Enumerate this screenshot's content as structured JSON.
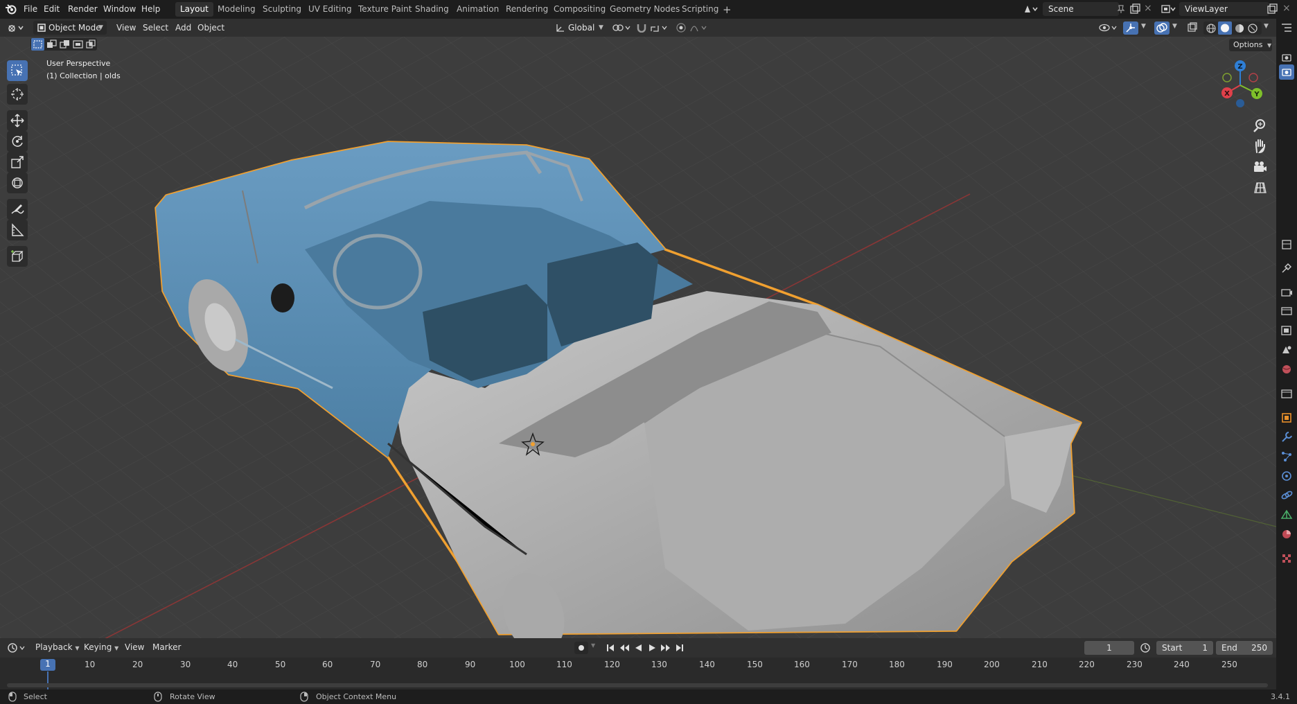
{
  "app": {
    "version": "3.4.1"
  },
  "menus": [
    "File",
    "Edit",
    "Render",
    "Window",
    "Help"
  ],
  "workspaces": [
    "Layout",
    "Modeling",
    "Sculpting",
    "UV Editing",
    "Texture Paint",
    "Shading",
    "Animation",
    "Rendering",
    "Compositing",
    "Geometry Nodes",
    "Scripting"
  ],
  "active_workspace": "Layout",
  "scene": {
    "name": "Scene"
  },
  "view_layer": {
    "name": "ViewLayer"
  },
  "header": {
    "mode": "Object Mode",
    "menu_view": "View",
    "menu_select": "Select",
    "menu_add": "Add",
    "menu_object": "Object",
    "transform_orientation": "Global",
    "options": "Options"
  },
  "viewport": {
    "perspective_label": "User Perspective",
    "collection_label": "(1) Collection | olds",
    "gizmo_axes": {
      "x": "X",
      "y": "Y",
      "z": "Z"
    },
    "colors": {
      "selection_outline": "#f0a030",
      "body_blue": "#5b8db0",
      "grid_x": "#a03030",
      "grid_y": "#6a8a30"
    }
  },
  "timeline": {
    "playback": "Playback",
    "keying": "Keying",
    "view": "View",
    "marker": "Marker",
    "current_frame": "1",
    "start_label": "Start",
    "start_value": "1",
    "end_label": "End",
    "end_value": "250",
    "ticks": [
      "1",
      "10",
      "20",
      "30",
      "40",
      "50",
      "60",
      "70",
      "80",
      "90",
      "100",
      "110",
      "120",
      "130",
      "140",
      "150",
      "160",
      "170",
      "180",
      "190",
      "200",
      "210",
      "220",
      "230",
      "240",
      "250"
    ]
  },
  "status": {
    "select": "Select",
    "rotate": "Rotate View",
    "context": "Object Context Menu",
    "version": "3.4.1"
  }
}
